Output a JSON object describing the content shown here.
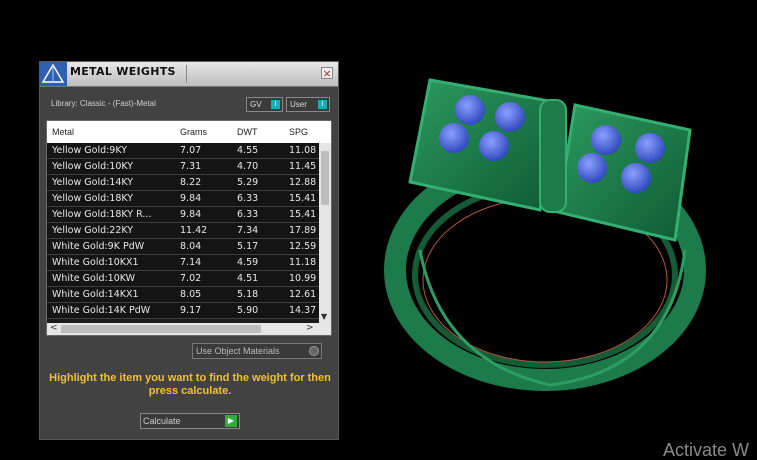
{
  "panel": {
    "title": "METAL WEIGHTS",
    "close_label": "×",
    "library_label": "Library: Classic - (Fast)-Metal",
    "toggles": [
      {
        "label": "GV",
        "indicator": "I"
      },
      {
        "label": "User",
        "indicator": "I"
      }
    ],
    "columns": [
      "Metal",
      "Grams",
      "DWT",
      "SPG"
    ],
    "rows": [
      {
        "metal": "Yellow Gold:9KY",
        "grams": "7.07",
        "dwt": "4.55",
        "spg": "11.08"
      },
      {
        "metal": "Yellow Gold:10KY",
        "grams": "7.31",
        "dwt": "4.70",
        "spg": "11.45"
      },
      {
        "metal": "Yellow Gold:14KY",
        "grams": "8.22",
        "dwt": "5.29",
        "spg": "12.88"
      },
      {
        "metal": "Yellow Gold:18KY",
        "grams": "9.84",
        "dwt": "6.33",
        "spg": "15.41"
      },
      {
        "metal": "Yellow Gold:18KY R...",
        "grams": "9.84",
        "dwt": "6.33",
        "spg": "15.41"
      },
      {
        "metal": "Yellow Gold:22KY",
        "grams": "11.42",
        "dwt": "7.34",
        "spg": "17.89"
      },
      {
        "metal": "White Gold:9K PdW",
        "grams": "8.04",
        "dwt": "5.17",
        "spg": "12.59"
      },
      {
        "metal": "White Gold:10KX1",
        "grams": "7.14",
        "dwt": "4.59",
        "spg": "11.18"
      },
      {
        "metal": "White Gold:10KW",
        "grams": "7.02",
        "dwt": "4.51",
        "spg": "10.99"
      },
      {
        "metal": "White Gold:14KX1",
        "grams": "8.05",
        "dwt": "5.18",
        "spg": "12.61"
      },
      {
        "metal": "White Gold:14K PdW",
        "grams": "9.17",
        "dwt": "5.90",
        "spg": "14.37"
      }
    ],
    "use_object_materials_label": "Use Object Materials",
    "instructions": "Highlight the item you want to find the weight for then press calculate.",
    "calculate_label": "Calculate",
    "scroll_up": "▲",
    "scroll_down": "▼",
    "scroll_left": "<",
    "scroll_right": ">"
  },
  "watermark": "Activate W",
  "colors": {
    "ring_green": "#1d7a4a",
    "stone_blue": "#4c6de0",
    "instruction_yellow": "#f2c12e"
  }
}
